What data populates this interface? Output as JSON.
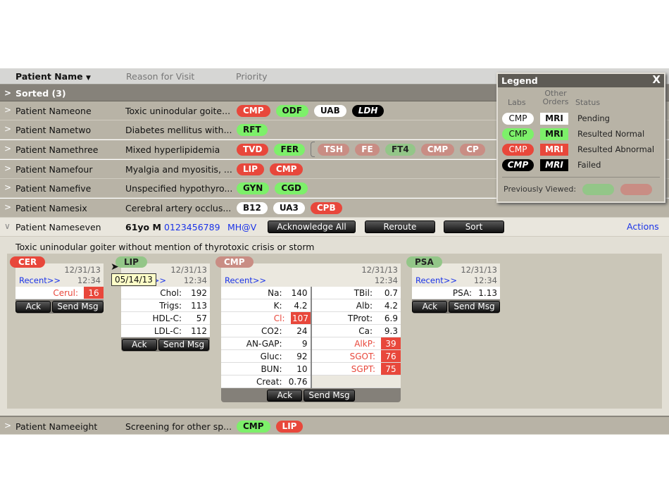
{
  "header": {
    "col_name": "Patient Name",
    "col_reason": "Reason for Visit",
    "col_priority": "Priority"
  },
  "sorted": {
    "label": "Sorted (3)"
  },
  "rows": [
    {
      "name": "Patient Nameone",
      "reason": "Toxic uninodular goite...",
      "pills": [
        {
          "label": "CMP",
          "status": "red"
        },
        {
          "label": "ODF",
          "status": "green"
        },
        {
          "label": "UAB",
          "status": "white"
        },
        {
          "label": "LDH",
          "status": "black"
        }
      ]
    },
    {
      "name": "Patient Nametwo",
      "reason": "Diabetes mellitus with...",
      "pills": [
        {
          "label": "RFT",
          "status": "green"
        }
      ]
    },
    {
      "name": "Patient Namethree",
      "reason": "Mixed hyperlipidemia",
      "pills": [
        {
          "label": "TVD",
          "status": "red"
        },
        {
          "label": "FER",
          "status": "green"
        }
      ],
      "previous": [
        {
          "label": "TSH",
          "status": "fred"
        },
        {
          "label": "FE",
          "status": "fred"
        },
        {
          "label": "FT4",
          "status": "fgreen"
        },
        {
          "label": "CMP",
          "status": "fred"
        },
        {
          "label": "CP",
          "status": "fred"
        }
      ]
    },
    {
      "name": "Patient Namefour",
      "reason": "Myalgia and myositis, ...",
      "pills": [
        {
          "label": "LIP",
          "status": "red"
        },
        {
          "label": "CMP",
          "status": "red"
        }
      ]
    },
    {
      "name": "Patient Namefive",
      "reason": "Unspecified hypothyro...",
      "pills": [
        {
          "label": "GYN",
          "status": "green"
        },
        {
          "label": "CGD",
          "status": "green"
        }
      ]
    },
    {
      "name": "Patient Namesix",
      "reason": "Cerebral artery occlus...",
      "pills": [
        {
          "label": "B12",
          "status": "white"
        },
        {
          "label": "UA3",
          "status": "white"
        },
        {
          "label": "CPB",
          "status": "red"
        }
      ]
    }
  ],
  "expanded": {
    "name": "Patient Nameseven",
    "age_sex": "61yo M",
    "phone": "0123456789",
    "provider": "MH@V",
    "ack_all": "Acknowledge All",
    "reroute": "Reroute",
    "sort": "Sort",
    "actions": "Actions",
    "reason_full": "Toxic uninodular goiter without mention of thyrotoxic crisis or storm",
    "tooltip": "05/14/13",
    "cards": [
      {
        "tab": "CER",
        "status": "red",
        "date": "12/31/13",
        "time": "12:34",
        "recent": "Recent>>",
        "columns": [
          [
            {
              "label": "Cerul:",
              "value": "16",
              "abnormal": true
            }
          ]
        ],
        "ack": "Ack",
        "send": "Send Msg"
      },
      {
        "tab": "LIP",
        "status": "fgreen",
        "date": "12/31/13",
        "time": "12:34",
        "recent": "Recent>>",
        "columns": [
          [
            {
              "label": "Chol:",
              "value": "192"
            },
            {
              "label": "Trigs:",
              "value": "113"
            },
            {
              "label": "HDL-C:",
              "value": "57"
            },
            {
              "label": "LDL-C:",
              "value": "112"
            }
          ]
        ],
        "ack": "Ack",
        "send": "Send Msg"
      },
      {
        "tab": "CMP",
        "status": "fred",
        "date": "12/31/13",
        "time": "12:34",
        "recent": "Recent>>",
        "columns": [
          [
            {
              "label": "Na:",
              "value": "140"
            },
            {
              "label": "K:",
              "value": "4.2"
            },
            {
              "label": "Cl:",
              "value": "107",
              "abnormal": true
            },
            {
              "label": "CO2:",
              "value": "24"
            },
            {
              "label": "AN-GAP:",
              "value": "9"
            },
            {
              "label": "Gluc:",
              "value": "92"
            },
            {
              "label": "BUN:",
              "value": "10"
            },
            {
              "label": "Creat:",
              "value": "0.76"
            }
          ],
          [
            {
              "label": "TBil:",
              "value": "0.7"
            },
            {
              "label": "Alb:",
              "value": "4.2"
            },
            {
              "label": "TProt:",
              "value": "6.9"
            },
            {
              "label": "Ca:",
              "value": "9.3"
            },
            {
              "label": "AlkP:",
              "value": "39",
              "abnormal": true
            },
            {
              "label": "SGOT:",
              "value": "76",
              "abnormal": true
            },
            {
              "label": "SGPT:",
              "value": "75",
              "abnormal": true
            }
          ]
        ],
        "ack": "Ack",
        "send": "Send Msg"
      },
      {
        "tab": "PSA",
        "status": "fgreen",
        "date": "12/31/13",
        "time": "12:34",
        "recent": "Recent>>",
        "columns": [
          [
            {
              "label": "PSA:",
              "value": "1.13"
            }
          ]
        ],
        "ack": "Ack",
        "send": "Send Msg"
      }
    ]
  },
  "last_row": {
    "name": "Patient Nameeight",
    "reason": "Screening for other sp...",
    "pills": [
      {
        "label": "CMP",
        "status": "green"
      },
      {
        "label": "LIP",
        "status": "red"
      }
    ]
  },
  "legend": {
    "title": "Legend",
    "close": "X",
    "col_labs": "Labs",
    "col_other": "Other Orders",
    "col_status": "Status",
    "items": [
      {
        "lab": "CMP",
        "other": "MRI",
        "status": "Pending",
        "color": "white"
      },
      {
        "lab": "CMP",
        "other": "MRI",
        "status": "Resulted Normal",
        "color": "green"
      },
      {
        "lab": "CMP",
        "other": "MRI",
        "status": "Resulted Abnormal",
        "color": "red"
      },
      {
        "lab": "CMP",
        "other": "MRI",
        "status": "Failed",
        "color": "black"
      }
    ],
    "previously_viewed": "Previously Viewed:"
  },
  "colors": {
    "red": "#e8473b",
    "green": "#7df06a",
    "faded_red": "#c98d84",
    "faded_green": "#93c688"
  }
}
